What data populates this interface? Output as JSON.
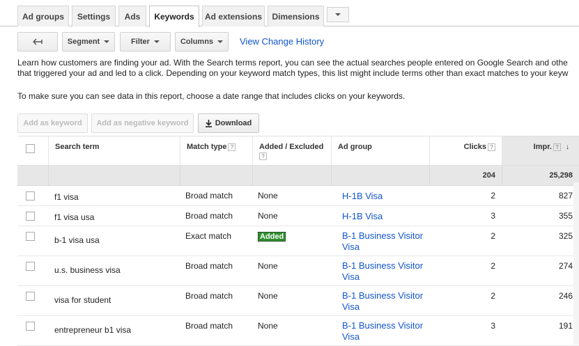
{
  "tabs": [
    "Ad groups",
    "Settings",
    "Ads",
    "Keywords",
    "Ad extensions",
    "Dimensions"
  ],
  "active_tab": "Keywords",
  "toolbar": {
    "back_icon": "back-arrow-icon",
    "segment": "Segment",
    "filter": "Filter",
    "columns": "Columns",
    "view_change_history": "View Change History"
  },
  "intro_line1": "Learn how customers are finding your ad. With the Search terms report, you can see the actual searches people entered on Google Search and othe",
  "intro_line2": "that triggered your ad and led to a click. Depending on your keyword match types, this list might include terms other than exact matches to your keyw",
  "date_note": "To make sure you can see data in this report, choose a date range that includes clicks on your keywords.",
  "actions": {
    "add_keyword": "Add as keyword",
    "add_negative": "Add as negative keyword",
    "download": "Download"
  },
  "columns": {
    "search_term": "Search term",
    "match_type": "Match type",
    "added_excluded": "Added / Excluded",
    "ad_group": "Ad group",
    "clicks": "Clicks",
    "impr": "Impr."
  },
  "totals": {
    "clicks": "204",
    "impr": "25,298"
  },
  "rows": [
    {
      "term": "f1 visa",
      "match": "Broad match",
      "added": "None",
      "added_badge": false,
      "ad_group_1": "H-1B Visa",
      "ad_group_2": "",
      "clicks": "2",
      "impr": "827"
    },
    {
      "term": "f1 visa usa",
      "match": "Broad match",
      "added": "None",
      "added_badge": false,
      "ad_group_1": "H-1B Visa",
      "ad_group_2": "",
      "clicks": "3",
      "impr": "355"
    },
    {
      "term": "b-1 visa usa",
      "match": "Exact match",
      "added": "Added",
      "added_badge": true,
      "ad_group_1": "B-1 Business Visitor",
      "ad_group_2": "Visa",
      "clicks": "2",
      "impr": "325"
    },
    {
      "term": "u.s. business visa",
      "match": "Broad match",
      "added": "None",
      "added_badge": false,
      "ad_group_1": "B-1 Business Visitor",
      "ad_group_2": "Visa",
      "clicks": "2",
      "impr": "274"
    },
    {
      "term": "visa for student",
      "match": "Broad match",
      "added": "None",
      "added_badge": false,
      "ad_group_1": "B-1 Business Visitor",
      "ad_group_2": "Visa",
      "clicks": "2",
      "impr": "246"
    },
    {
      "term": "entrepreneur b1 visa",
      "match": "Broad match",
      "added": "None",
      "added_badge": false,
      "ad_group_1": "B-1 Business Visitor",
      "ad_group_2": "Visa",
      "clicks": "3",
      "impr": "191"
    }
  ]
}
